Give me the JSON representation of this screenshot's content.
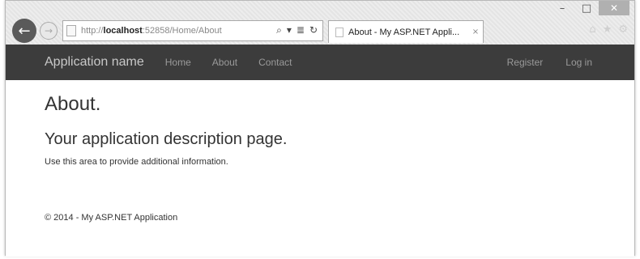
{
  "window": {
    "minimize_glyph": "–",
    "maximize_glyph": "□",
    "close_glyph": "✕"
  },
  "browser": {
    "back_glyph": "←",
    "forward_glyph": "→",
    "address": {
      "prefix": "http://",
      "host": "localhost",
      "rest": ":52858/Home/About"
    },
    "search_glyph": "⌕",
    "dropdown_glyph": "▾",
    "compat_glyph": "≣",
    "refresh_glyph": "↻",
    "tab": {
      "title": "About - My ASP.NET Appli...",
      "close_glyph": "×"
    },
    "home_glyph": "⌂",
    "favorites_glyph": "★",
    "tools_glyph": "⚙"
  },
  "navbar": {
    "brand": "Application name",
    "links": [
      {
        "label": "Home"
      },
      {
        "label": "About"
      },
      {
        "label": "Contact"
      }
    ],
    "right_links": [
      {
        "label": "Register"
      },
      {
        "label": "Log in"
      }
    ]
  },
  "main": {
    "title": "About.",
    "subtitle": "Your application description page.",
    "text": "Use this area to provide additional information."
  },
  "footer": {
    "text": "© 2014 - My ASP.NET Application"
  }
}
